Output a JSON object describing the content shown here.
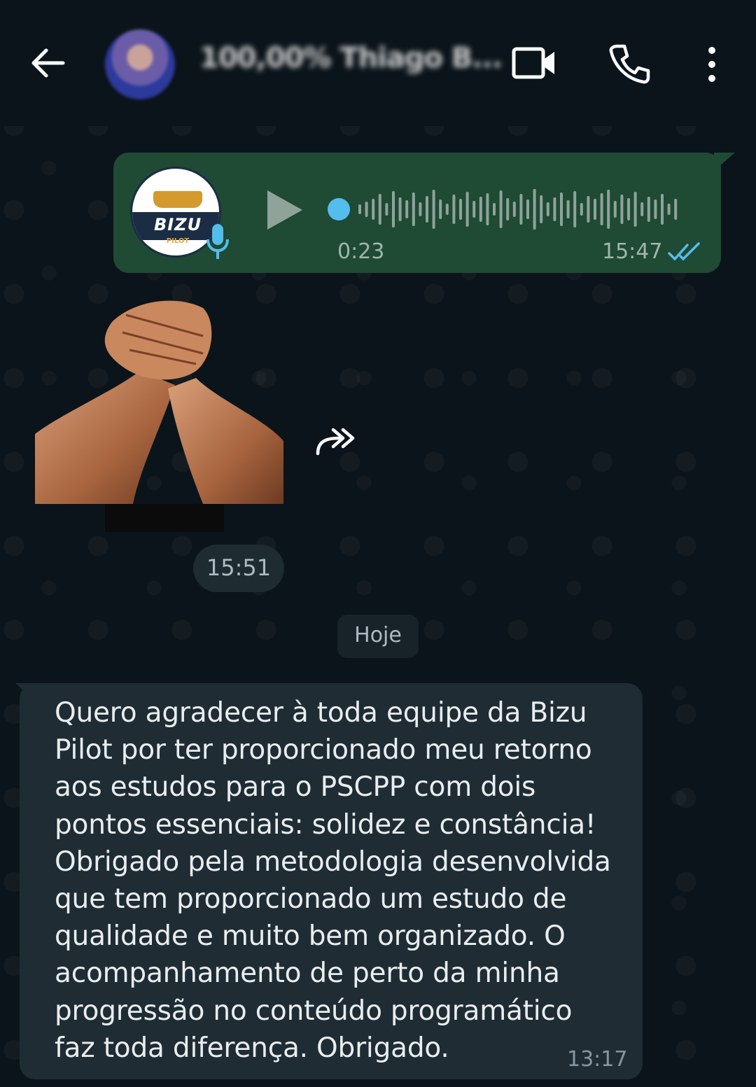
{
  "header": {
    "contact_name": "100,00% Thiago B...",
    "icons": [
      "back-arrow-icon",
      "avatar",
      "video-call-icon",
      "phone-call-icon",
      "more-options-icon"
    ]
  },
  "voice_message": {
    "sender_logo_text": "BIZU",
    "sender_logo_sub": "PILOT",
    "duration": "0:23",
    "time": "15:47",
    "status": "read",
    "progress": 0
  },
  "sticker_message": {
    "sticker_text": "",
    "time": "15:51"
  },
  "date_separator": {
    "label": "Hoje"
  },
  "text_message": {
    "lines": [
      "Quero agradecer à toda equipe da Bizu",
      "Pilot por ter proporcionado meu retorno",
      "aos estudos para o PSCPP com dois",
      "pontos essenciais: solidez e constância!",
      "Obrigado pela metodologia desenvolvida",
      "que tem proporcionado um estudo de",
      "qualidade e muito bem organizado. O",
      "acompanhamento de perto da minha",
      "progressão no conteúdo programático",
      "faz toda diferença. Obrigado."
    ],
    "time": "13:17"
  },
  "colors": {
    "background": "#0b141a",
    "outgoing_bubble": "#1f4a34",
    "incoming_bubble": "#1f2c34",
    "accent_blue": "#53bdeb"
  }
}
